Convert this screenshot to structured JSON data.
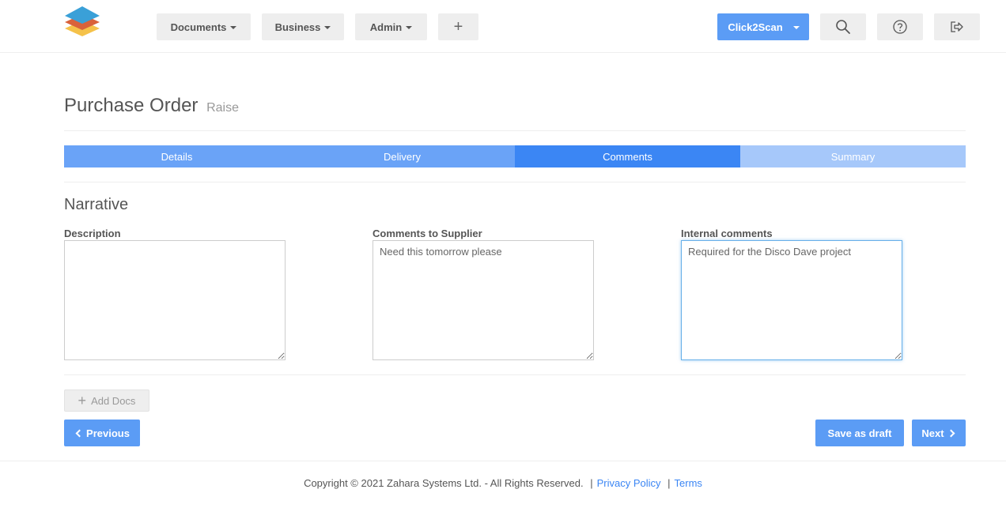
{
  "nav": {
    "documents": "Documents",
    "business": "Business",
    "admin": "Admin",
    "add": "+",
    "scan": "Click2Scan"
  },
  "icons": {
    "search": "search-icon",
    "help": "help-icon",
    "logout": "logout-icon"
  },
  "page": {
    "title": "Purchase Order",
    "subtitle": "Raise"
  },
  "steps": [
    "Details",
    "Delivery",
    "Comments",
    "Summary"
  ],
  "active_step": "Comments",
  "section": {
    "title": "Narrative"
  },
  "fields": {
    "description": {
      "label": "Description",
      "value": ""
    },
    "supplier": {
      "label": "Comments to Supplier",
      "value": "Need this tomorrow please"
    },
    "internal": {
      "label": "Internal comments",
      "value": "Required for the Disco Dave project"
    }
  },
  "actions": {
    "add_docs": "Add Docs",
    "previous": "Previous",
    "save_draft": "Save as draft",
    "next": "Next"
  },
  "footer": {
    "copyright": "Copyright © 2021 Zahara Systems Ltd. - All Rights Reserved.",
    "sep": "|",
    "privacy": "Privacy Policy",
    "terms": "Terms"
  },
  "colors": {
    "primary": "#5b9cf5",
    "step_done": "#6aa3f7",
    "step_active": "#3b86f4",
    "step_todo": "#a6c8fa"
  }
}
